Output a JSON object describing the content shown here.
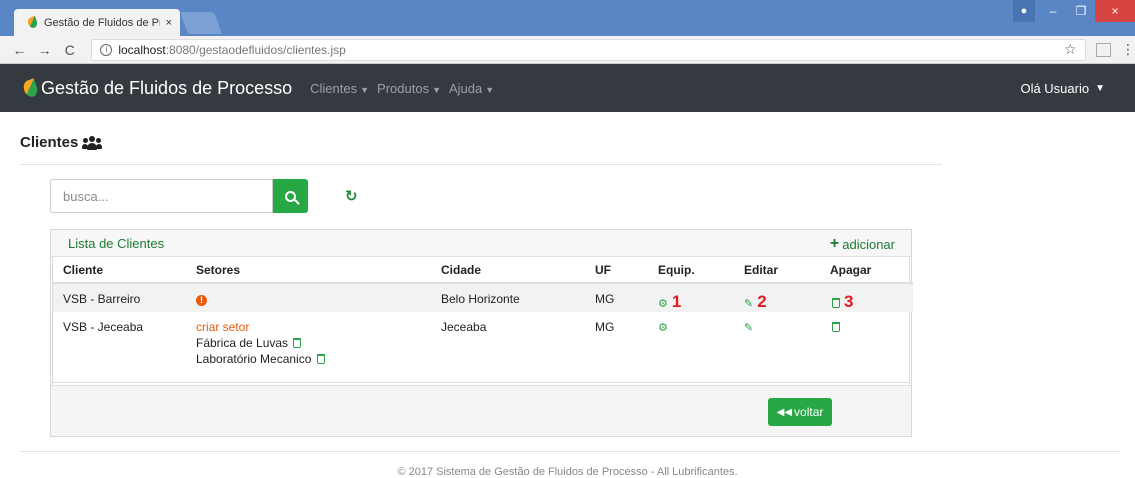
{
  "browser": {
    "tab_title": "Gestão de Fluidos de Pro",
    "tab_close": "×",
    "url_host": "localhost",
    "url_path": ":8080/gestaodefluidos/clientes.jsp",
    "back": "←",
    "forward": "→",
    "reload": "C",
    "info": "i",
    "star": "☆",
    "menu": "⋮",
    "win_min": "–",
    "win_max": "❐",
    "win_close": "×"
  },
  "navbar": {
    "brand": "Gestão de Fluidos de Processo",
    "menus": [
      "Clientes",
      "Produtos",
      "Ajuda"
    ],
    "user": "Olá Usuario"
  },
  "page": {
    "title": "Clientes",
    "search_placeholder": "busca...",
    "refresh_glyph": "↻"
  },
  "panel": {
    "title": "Lista de Clientes",
    "add_label": "adicionar",
    "add_glyph": "+",
    "headers": [
      "Cliente",
      "Setores",
      "Cidade",
      "UF",
      "Equip.",
      "Editar",
      "Apagar"
    ],
    "rows": [
      {
        "cliente": "VSB - Barreiro",
        "setor_warning": "!",
        "cidade": "Belo Horizonte",
        "uf": "MG",
        "equip_glyph": "⚙",
        "edit_glyph": "✎",
        "marker_equip": "1",
        "marker_edit": "2",
        "marker_delete": "3"
      },
      {
        "cliente": "VSB - Jeceaba",
        "criar_setor": "criar setor",
        "setores": [
          "Fábrica de Luvas",
          "Laboratório Mecanico"
        ],
        "cidade": "Jeceaba",
        "uf": "MG",
        "equip_glyph": "⚙",
        "edit_glyph": "✎"
      }
    ],
    "back_label": "voltar",
    "back_glyph": "◀◀"
  },
  "footer": "© 2017 Sistema de Gestão de Fluidos de Processo - All Lubrificantes.",
  "colors": {
    "accent_green": "#28a745",
    "navbar_bg": "#343a40",
    "warning_orange": "#e8590c",
    "marker_red": "#e01b24",
    "tabstrip_blue": "#5b86c5"
  },
  "icons": {
    "users": "users-icon",
    "search": "search-icon",
    "refresh": "refresh-icon",
    "add": "plus-icon",
    "equip": "cogs-icon",
    "edit": "edit-icon",
    "delete": "trash-icon",
    "warning": "exclamation-circle-icon",
    "back": "backward-icon"
  }
}
